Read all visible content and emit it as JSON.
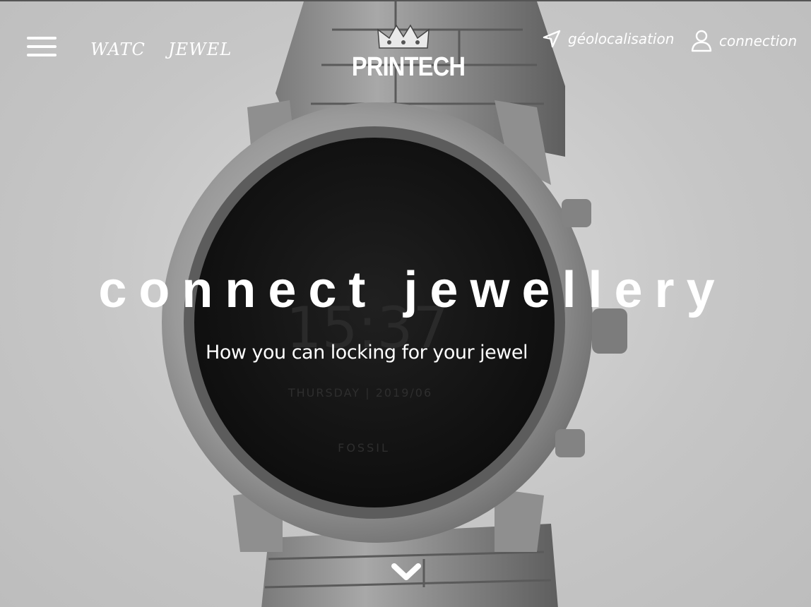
{
  "nav": {
    "menu_icon": "hamburger-menu-icon",
    "watch_label": "WATC",
    "jewel_label": "JEWEL",
    "geolocation_label": "géolocalisation",
    "geolocation_icon": "location-arrow-icon",
    "connection_label": "connection",
    "connection_icon": "user-icon"
  },
  "logo": {
    "brand": "PRINTECH",
    "emblem_icon": "crown-icon"
  },
  "hero": {
    "title": "connect jewellery",
    "subtitle": "How you can locking for your jewel",
    "scroll_icon": "chevron-down-icon",
    "background_image": "smartwatch-photo",
    "watch_face": {
      "time": "15:37",
      "date": "THURSDAY | 2019/06",
      "brand": "FOSSIL"
    }
  },
  "colors": {
    "text": "#ffffff",
    "background": "#c9c9c9",
    "watch_face": "#121212",
    "metal": "#8c8c8c"
  }
}
